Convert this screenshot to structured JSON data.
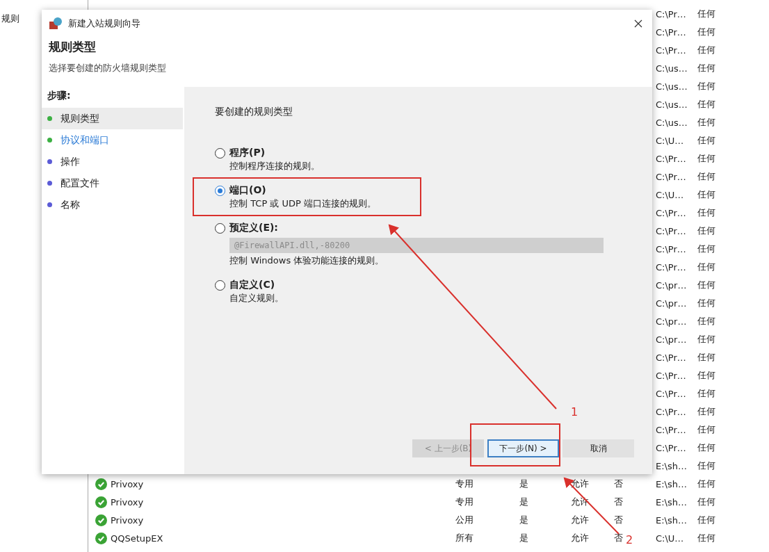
{
  "left_panel": {
    "label": "规则"
  },
  "rows": [
    {
      "program": "C:\\Pr…",
      "local": "任何"
    },
    {
      "program": "C:\\Pr…",
      "local": "任何"
    },
    {
      "program": "C:\\Pr…",
      "local": "任何"
    },
    {
      "program": "C:\\us…",
      "local": "任何"
    },
    {
      "program": "C:\\us…",
      "local": "任何"
    },
    {
      "program": "C:\\us…",
      "local": "任何"
    },
    {
      "program": "C:\\us…",
      "local": "任何"
    },
    {
      "program": "C:\\U…",
      "local": "任何"
    },
    {
      "program": "C:\\Pr…",
      "local": "任何"
    },
    {
      "program": "C:\\Pr…",
      "local": "任何"
    },
    {
      "program": "C:\\U…",
      "local": "任何"
    },
    {
      "program": "C:\\Pr…",
      "local": "任何"
    },
    {
      "program": "C:\\Pr…",
      "local": "任何"
    },
    {
      "program": "C:\\Pr…",
      "local": "任何"
    },
    {
      "program": "C:\\Pr…",
      "local": "任何"
    },
    {
      "program": "C:\\pr…",
      "local": "任何"
    },
    {
      "program": "C:\\pr…",
      "local": "任何"
    },
    {
      "program": "C:\\pr…",
      "local": "任何"
    },
    {
      "program": "C:\\pr…",
      "local": "任何"
    },
    {
      "program": "C:\\Pr…",
      "local": "任何"
    },
    {
      "program": "C:\\Pr…",
      "local": "任何"
    },
    {
      "program": "C:\\Pr…",
      "local": "任何"
    },
    {
      "program": "C:\\Pr…",
      "local": "任何"
    },
    {
      "program": "C:\\Pr…",
      "local": "任何"
    },
    {
      "program": "C:\\Pr…",
      "local": "任何"
    },
    {
      "program": "E:\\sh…",
      "local": "任何"
    },
    {
      "name": "Privoxy",
      "profile": "专用",
      "enabled": "是",
      "action": "允许",
      "override": "否",
      "program": "E:\\sh…",
      "local": "任何"
    },
    {
      "name": "Privoxy",
      "profile": "专用",
      "enabled": "是",
      "action": "允许",
      "override": "否",
      "program": "E:\\sh…",
      "local": "任何"
    },
    {
      "name": "Privoxy",
      "profile": "公用",
      "enabled": "是",
      "action": "允许",
      "override": "否",
      "program": "E:\\sh…",
      "local": "任何"
    },
    {
      "name": "QQSetupEX",
      "profile": "所有",
      "enabled": "是",
      "action": "允许",
      "override": "否",
      "program": "C:\\U…",
      "local": "任何"
    }
  ],
  "dialog": {
    "title": "新建入站规则向导",
    "heading": "规则类型",
    "subheading": "选择要创建的防火墙规则类型",
    "steps_label": "步骤:",
    "steps": [
      {
        "label": "规则类型",
        "selected": true,
        "link": false,
        "color": "#3cb043"
      },
      {
        "label": "协议和端口",
        "selected": false,
        "link": true,
        "color": "#3cb043"
      },
      {
        "label": "操作",
        "selected": false,
        "link": false,
        "color": "#5b5bd6"
      },
      {
        "label": "配置文件",
        "selected": false,
        "link": false,
        "color": "#5b5bd6"
      },
      {
        "label": "名称",
        "selected": false,
        "link": false,
        "color": "#5b5bd6"
      }
    ],
    "prompt": "要创建的规则类型",
    "options": [
      {
        "label": "程序(P)",
        "description": "控制程序连接的规则。",
        "selected": false
      },
      {
        "label": "端口(O)",
        "description": "控制 TCP 或 UDP 端口连接的规则。",
        "selected": true
      },
      {
        "label": "预定义(E):",
        "description": "控制 Windows 体验功能连接的规则。",
        "selected": false,
        "dropdown": {
          "value": "@FirewallAPI.dll,-80200",
          "disabled": true
        }
      },
      {
        "label": "自定义(C)",
        "description": "自定义规则。",
        "selected": false
      }
    ],
    "buttons": [
      {
        "label": "< 上一步(B)",
        "disabled": true,
        "focused": false
      },
      {
        "label": "下一步(N) >",
        "disabled": false,
        "focused": true
      },
      {
        "label": "取消",
        "disabled": false,
        "focused": false
      }
    ]
  },
  "annotations": [
    {
      "text": "1"
    },
    {
      "text": "2"
    }
  ]
}
